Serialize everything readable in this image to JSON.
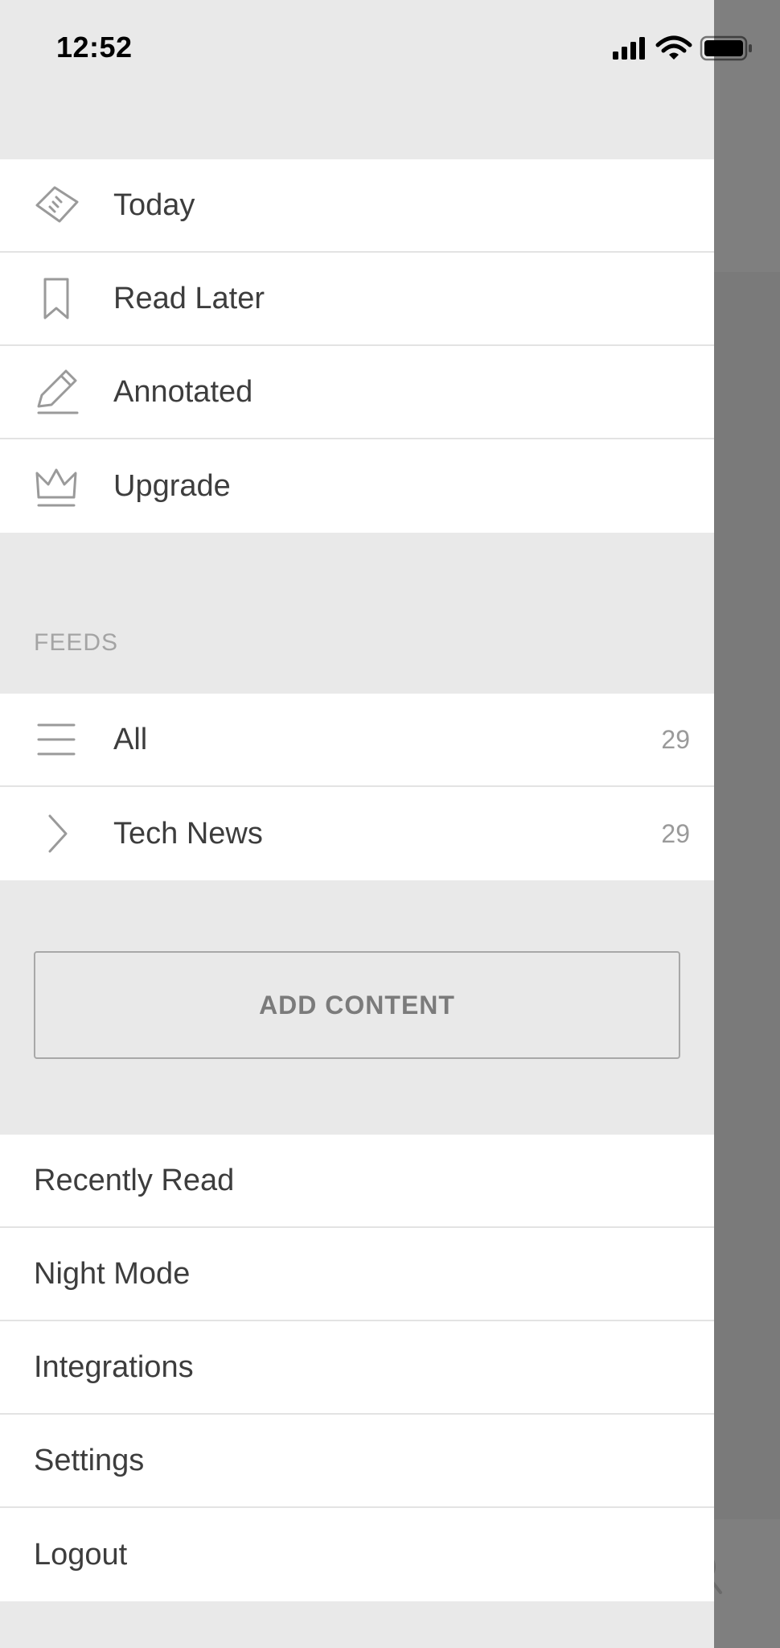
{
  "status_bar": {
    "time": "12:52"
  },
  "nav": {
    "items": [
      {
        "label": "Today",
        "icon": "today-tag-icon"
      },
      {
        "label": "Read Later",
        "icon": "bookmark-icon"
      },
      {
        "label": "Annotated",
        "icon": "pencil-icon"
      },
      {
        "label": "Upgrade",
        "icon": "crown-icon"
      }
    ]
  },
  "feeds": {
    "header": "FEEDS",
    "items": [
      {
        "label": "All",
        "count": "29",
        "icon": "list-icon"
      },
      {
        "label": "Tech News",
        "count": "29",
        "icon": "chevron-right-icon"
      }
    ]
  },
  "add_content": {
    "label": "ADD CONTENT"
  },
  "bottom_menu": {
    "items": [
      {
        "label": "Recently Read"
      },
      {
        "label": "Night Mode"
      },
      {
        "label": "Integrations"
      },
      {
        "label": "Settings"
      },
      {
        "label": "Logout"
      }
    ]
  },
  "colors": {
    "drawer_background": "#e9e9e9",
    "row_background": "#ffffff",
    "overlay": "#7a7a7a",
    "text_primary": "#3d3d3d",
    "text_muted": "#9a9a9a"
  }
}
